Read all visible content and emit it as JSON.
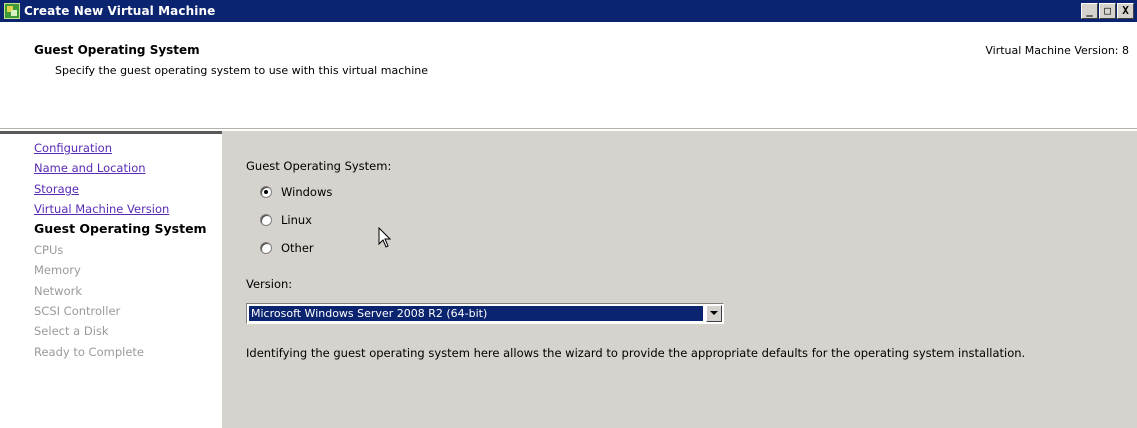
{
  "window": {
    "title": "Create New Virtual Machine",
    "minimize": "_",
    "maximize": "□",
    "close": "X"
  },
  "header": {
    "title": "Guest Operating System",
    "subtitle": "Specify the guest operating system to use with this virtual machine",
    "version": "Virtual Machine Version: 8"
  },
  "nav": {
    "items": [
      {
        "label": "Configuration",
        "state": "done"
      },
      {
        "label": "Name and Location",
        "state": "done"
      },
      {
        "label": "Storage",
        "state": "done"
      },
      {
        "label": "Virtual Machine Version",
        "state": "done"
      },
      {
        "label": "Guest Operating System",
        "state": "current"
      },
      {
        "label": "CPUs",
        "state": "future"
      },
      {
        "label": "Memory",
        "state": "future"
      },
      {
        "label": "Network",
        "state": "future"
      },
      {
        "label": "SCSI Controller",
        "state": "future"
      },
      {
        "label": "Select a Disk",
        "state": "future"
      },
      {
        "label": "Ready to Complete",
        "state": "future"
      }
    ]
  },
  "content": {
    "guest_os_label": "Guest Operating System:",
    "options": [
      {
        "label": "Windows",
        "selected": true
      },
      {
        "label": "Linux",
        "selected": false
      },
      {
        "label": "Other",
        "selected": false
      }
    ],
    "version_label": "Version:",
    "version_value": "Microsoft Windows Server 2008 R2 (64-bit)",
    "help_text": "Identifying the guest operating system here allows the wizard to provide the appropriate defaults for the operating system installation."
  }
}
